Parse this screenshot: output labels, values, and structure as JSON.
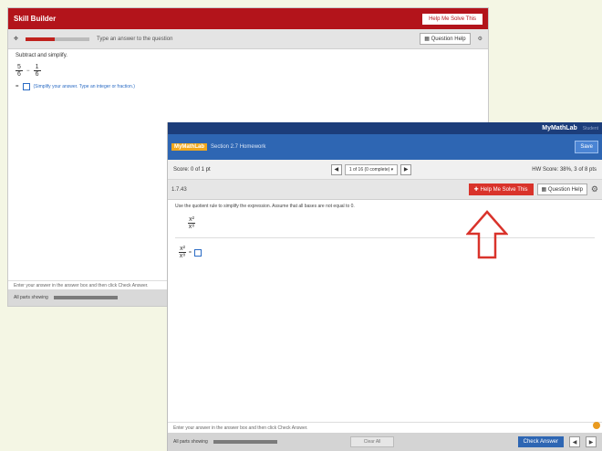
{
  "back": {
    "app_title": "Skill Builder",
    "help_button": "Help Me Solve This",
    "toolbar_text": "Type an answer to the question",
    "question_help": "Question Help",
    "instruction": "Subtract and simplify.",
    "math1": {
      "num": "5",
      "den": "6"
    },
    "math2": {
      "num": "1",
      "den": "6"
    },
    "link": "(Simplify your answer. Type an integer or fraction.)",
    "footer_text": "Enter your answer in the answer box and then click Check Answer.",
    "footer_status": "All parts showing",
    "progress": 0.45
  },
  "front": {
    "brand": "MyMathLab",
    "brand_suffix": "Student",
    "header_logo": "MyMathLab",
    "header_course": "Section 2.7 Homework",
    "save_button": "Save",
    "score": "Score: 0 of 1 pt",
    "question_selector": "1 of 16 (0 complete)",
    "hw_score": "HW Score: 38%, 3 of 8 pts",
    "question_id": "1.7.43",
    "help_me": "Help Me Solve This",
    "question_help": "Question Help",
    "instruction": "Use the quotient rule to simplify the expression. Assume that all bases are not equal to 0.",
    "math1": {
      "num": "x²",
      "den": "x⁸"
    },
    "math2": {
      "num": "x²",
      "den": "x⁸"
    },
    "footer_text": "Enter your answer in the answer box and then click Check Answer.",
    "footer_status": "All parts showing",
    "clear_all": "Clear All",
    "check_answer": "Check Answer"
  },
  "colors": {
    "back_accent": "#b3141b",
    "front_accent": "#2e66b3",
    "arrow": "#d9332b",
    "help_me_bg": "#d9332b"
  }
}
